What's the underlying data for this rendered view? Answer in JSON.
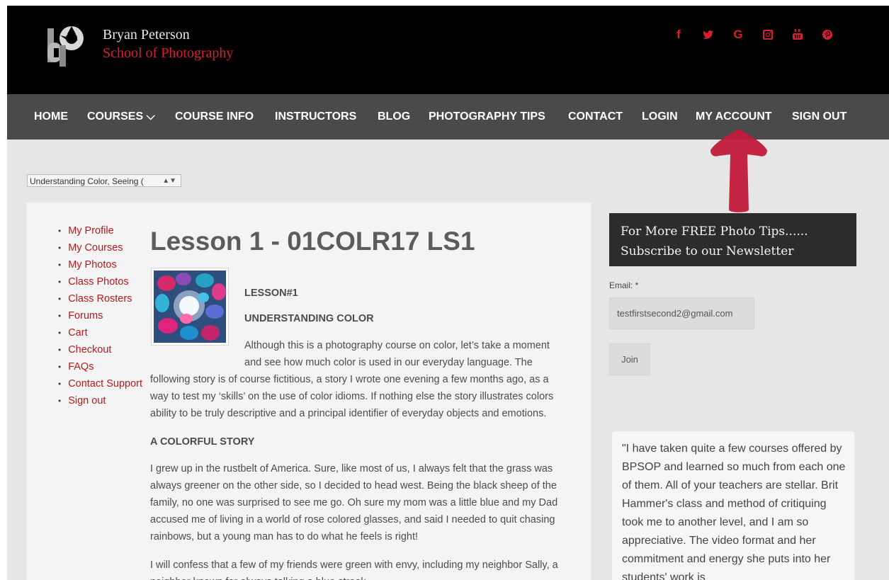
{
  "brand": {
    "line1": "Bryan Peterson",
    "line2": "School of Photography"
  },
  "social": [
    {
      "icon": "facebook-icon",
      "glyph": "f"
    },
    {
      "icon": "twitter-icon",
      "glyph": "twitter"
    },
    {
      "icon": "google-icon",
      "glyph": "G"
    },
    {
      "icon": "instagram-icon",
      "glyph": "instagram"
    },
    {
      "icon": "youtube-icon",
      "glyph": "youtube"
    },
    {
      "icon": "pinterest-icon",
      "glyph": "pinterest"
    }
  ],
  "nav": [
    {
      "label": "HOME"
    },
    {
      "label": "COURSES ⌵"
    },
    {
      "label": "COURSE INFO"
    },
    {
      "label": "INSTRUCTORS"
    },
    {
      "label": "BLOG"
    },
    {
      "label": "PHOTOGRAPHY TIPS"
    },
    {
      "label": "CONTACT"
    },
    {
      "label": "LOGIN"
    },
    {
      "label": "MY ACCOUNT"
    },
    {
      "label": "SIGN OUT"
    }
  ],
  "course_select": {
    "value": "Understanding Color, Seeing ("
  },
  "sidebar_nav": [
    "My Profile",
    "My Courses",
    "My Photos",
    "Class Photos",
    "Class Rosters",
    "Forums",
    "Cart",
    "Checkout",
    "FAQs",
    "Contact Support",
    "Sign out"
  ],
  "lesson": {
    "title": "Lesson 1 - 01COLR17 LS1",
    "label": "LESSON#1",
    "subtitle": "UNDERSTANDING COLOR",
    "p1_lines": [
      "Although this is a photography course on color, let’s take a moment",
      "and see how much color is used in our everyday language. The",
      "following story is of course fictitious, a story I wrote one evening a few months ago, as a",
      "way to test my ‘skills’ on the use of color idioms. If nothing else the story illustrates colors",
      "ability to be truly descriptive and a principal identifier of everyday objects and emotions."
    ],
    "section_title": "A COLORFUL STORY",
    "p2_lines": [
      "I grew up in the rustbelt of America. Sure, like most of us, I always felt that the grass was",
      "always greener on the other side, so I decided to head west. Being the black sheep of the",
      "family, no one was surprised to see me go. Oh sure my mom was a little blue and my Dad",
      "accused me of living in a world of rose colored glasses, and said I needed to quit chasing",
      "rainbows, but a young man has to do what he feels is right!"
    ],
    "p3_lines": [
      "I will confess that a few of my friends were green with envy, including my neighbor Sally, a",
      "neighbor known for always talking a blue streak."
    ]
  },
  "newsletter": {
    "line1": "For More FREE Photo Tips......",
    "line2": "Subscribe to our Newsletter",
    "email_label": "Email: *",
    "email_value": "testfirstsecond2@gmail.com",
    "join_label": "Join"
  },
  "testimonial": "\"I have taken quite a few courses offered by BPSOP and learned so much from each one of them. All of your teachers are stellar. Brit Hammer's class and method of critiquing took me to another level, and I am so appreciative. The video format and her commitment and energy she puts into her students' work is",
  "colors": {
    "accent": "#d91f2f",
    "nav_bg": "#4a4a4a",
    "header_bg": "#000000",
    "arrow": "#c11a3a"
  }
}
